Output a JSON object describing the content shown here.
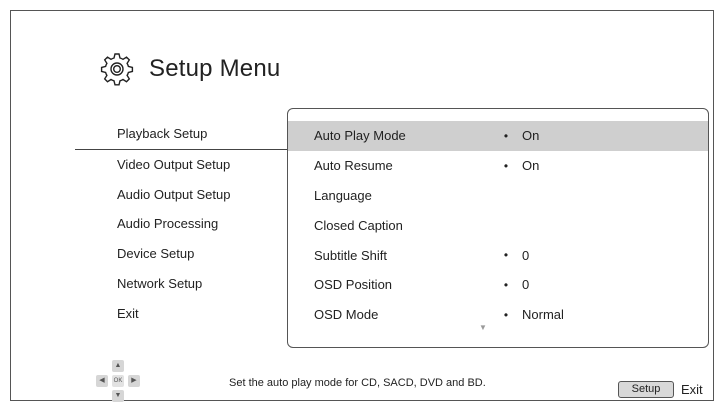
{
  "header": {
    "title": "Setup Menu",
    "icon": "gear-icon"
  },
  "left_menu": {
    "items": [
      {
        "label": "Playback Setup",
        "active": true
      },
      {
        "label": "Video Output Setup"
      },
      {
        "label": "Audio Output Setup"
      },
      {
        "label": "Audio Processing"
      },
      {
        "label": "Device Setup"
      },
      {
        "label": "Network Setup"
      },
      {
        "label": "Exit"
      }
    ]
  },
  "options": {
    "rows": [
      {
        "label": "Auto Play Mode",
        "value": "On",
        "bullet": "•",
        "selected": true
      },
      {
        "label": "Auto Resume",
        "value": "On",
        "bullet": "•"
      },
      {
        "label": "Language",
        "value": "",
        "bullet": ""
      },
      {
        "label": "Closed Caption",
        "value": "",
        "bullet": ""
      },
      {
        "label": "Subtitle Shift",
        "value": "0",
        "bullet": "•"
      },
      {
        "label": "OSD Position",
        "value": "0",
        "bullet": "•"
      },
      {
        "label": "OSD Mode",
        "value": "Normal",
        "bullet": "•"
      }
    ],
    "more_icon": "down-triangle-icon"
  },
  "footer": {
    "dpad": {
      "up": "▲",
      "down": "▼",
      "left": "◀",
      "right": "▶",
      "ok": "OK"
    },
    "hint": "Set the auto play mode for CD, SACD, DVD and BD.",
    "setup_button": "Setup",
    "exit_label": "Exit"
  },
  "colors": {
    "selected_row": "#cfcfcf",
    "border": "#555555"
  }
}
